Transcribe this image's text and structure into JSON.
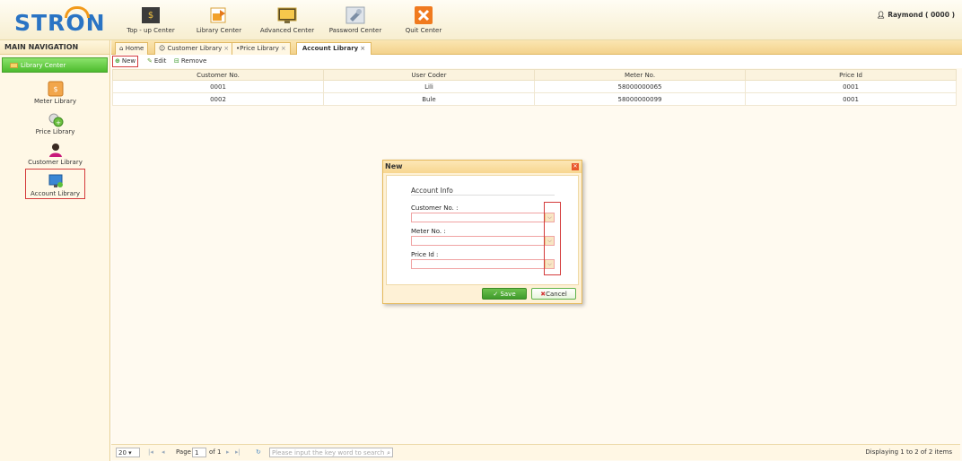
{
  "app": {
    "logo": "STRON"
  },
  "topnav": [
    {
      "label": "Top - up Center",
      "icon": "topup-icon"
    },
    {
      "label": "Library Center",
      "icon": "library-icon"
    },
    {
      "label": "Advanced Center",
      "icon": "advanced-icon"
    },
    {
      "label": "Password Center",
      "icon": "password-icon"
    },
    {
      "label": "Quit Center",
      "icon": "quit-icon"
    }
  ],
  "user": {
    "label": "Raymond ( 0000 )"
  },
  "sidebar": {
    "title": "MAIN NAVIGATION",
    "section": "Library Center",
    "items": [
      {
        "label": "Meter Library"
      },
      {
        "label": "Price Library"
      },
      {
        "label": "Customer Library"
      },
      {
        "label": "Account Library"
      }
    ]
  },
  "tabs": [
    {
      "label": "Home",
      "closable": false
    },
    {
      "label": "Customer Library",
      "closable": true
    },
    {
      "label": "Price Library",
      "closable": true
    },
    {
      "label": "Account Library",
      "closable": true,
      "active": true
    }
  ],
  "toolbar": {
    "new": "New",
    "edit": "Edit",
    "remove": "Remove"
  },
  "table": {
    "columns": [
      "Customer No.",
      "User Coder",
      "Meter No.",
      "Price Id"
    ],
    "rows": [
      [
        "0001",
        "Lili",
        "58000000065",
        "0001"
      ],
      [
        "0002",
        "Bule",
        "58000000099",
        "0001"
      ]
    ]
  },
  "pager": {
    "page_size": "20",
    "page_label": "Page",
    "page_value": "1",
    "of_label": "of 1",
    "search_placeholder": "Please input the key word to search",
    "display": "Displaying 1 to 2 of 2 items"
  },
  "dialog": {
    "title": "New",
    "legend": "Account Info",
    "customer_label": "Customer No. :",
    "meter_label": "Meter No. :",
    "price_label": "Price Id :",
    "save": "Save",
    "cancel": "Cancel"
  },
  "colors": {
    "accent": "#f29a1a",
    "brand": "#2a74c4",
    "green": "#4dbb2e",
    "highlight": "#d43b3b"
  }
}
